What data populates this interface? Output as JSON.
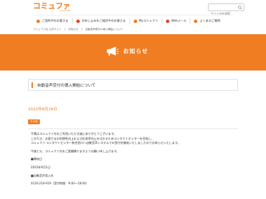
{
  "header": {
    "logo_text": "コミュファ",
    "logo_sub": "commufa",
    "search_placeholder": "サイト内を検索"
  },
  "nav": {
    "items": [
      {
        "label": "ご契約中のお客さま",
        "icon": "user-icon",
        "color": "#f07d22"
      },
      {
        "label": "お申し込みをご検討中のお客さま",
        "icon": "document-icon",
        "color": "#e6402f"
      },
      {
        "label": "Myコミュファ",
        "icon": "heart-icon",
        "color": "#f07d22"
      },
      {
        "label": "Webメール",
        "icon": "mail-icon",
        "color": "#e6402f"
      },
      {
        "label": "よくあるご質問",
        "icon": "question-icon",
        "color": "#f07d22"
      }
    ]
  },
  "breadcrumb": {
    "items": [
      "コミュファ光 公式サイト",
      "＞",
      "お知らせ",
      "＞",
      "自動音声受付の導入開始について"
    ]
  },
  "banner": {
    "title": "お知らせ",
    "icon": "megaphone-icon"
  },
  "article": {
    "headline": "自動音声受付の導入開始について",
    "date": "2022年8月26日",
    "badge": "その他",
    "body": [
      "平素はコミュファ光をご利用いただき誠にありがとうございます。",
      "このたび、お客さまの利便性向上および応答率向上をはかるためコンタクトセンターを目指し、",
      "コミュファ コンタクトセンター統合窓口へ自動音声システムでの受付を開始いたしましたのでお知らせいたします。",
      "",
      "今後とも、コミュファ光をご愛顧賜りますようお願い申し上げます。",
      "",
      "■開始日",
      "",
      "2022年9月1日",
      "",
      "■自動音声導入先",
      "",
      "0120-218-919（受付時間　9:00～18:00）"
    ]
  },
  "colors": {
    "accent": "#f07d22",
    "accent_red": "#e6402f"
  }
}
